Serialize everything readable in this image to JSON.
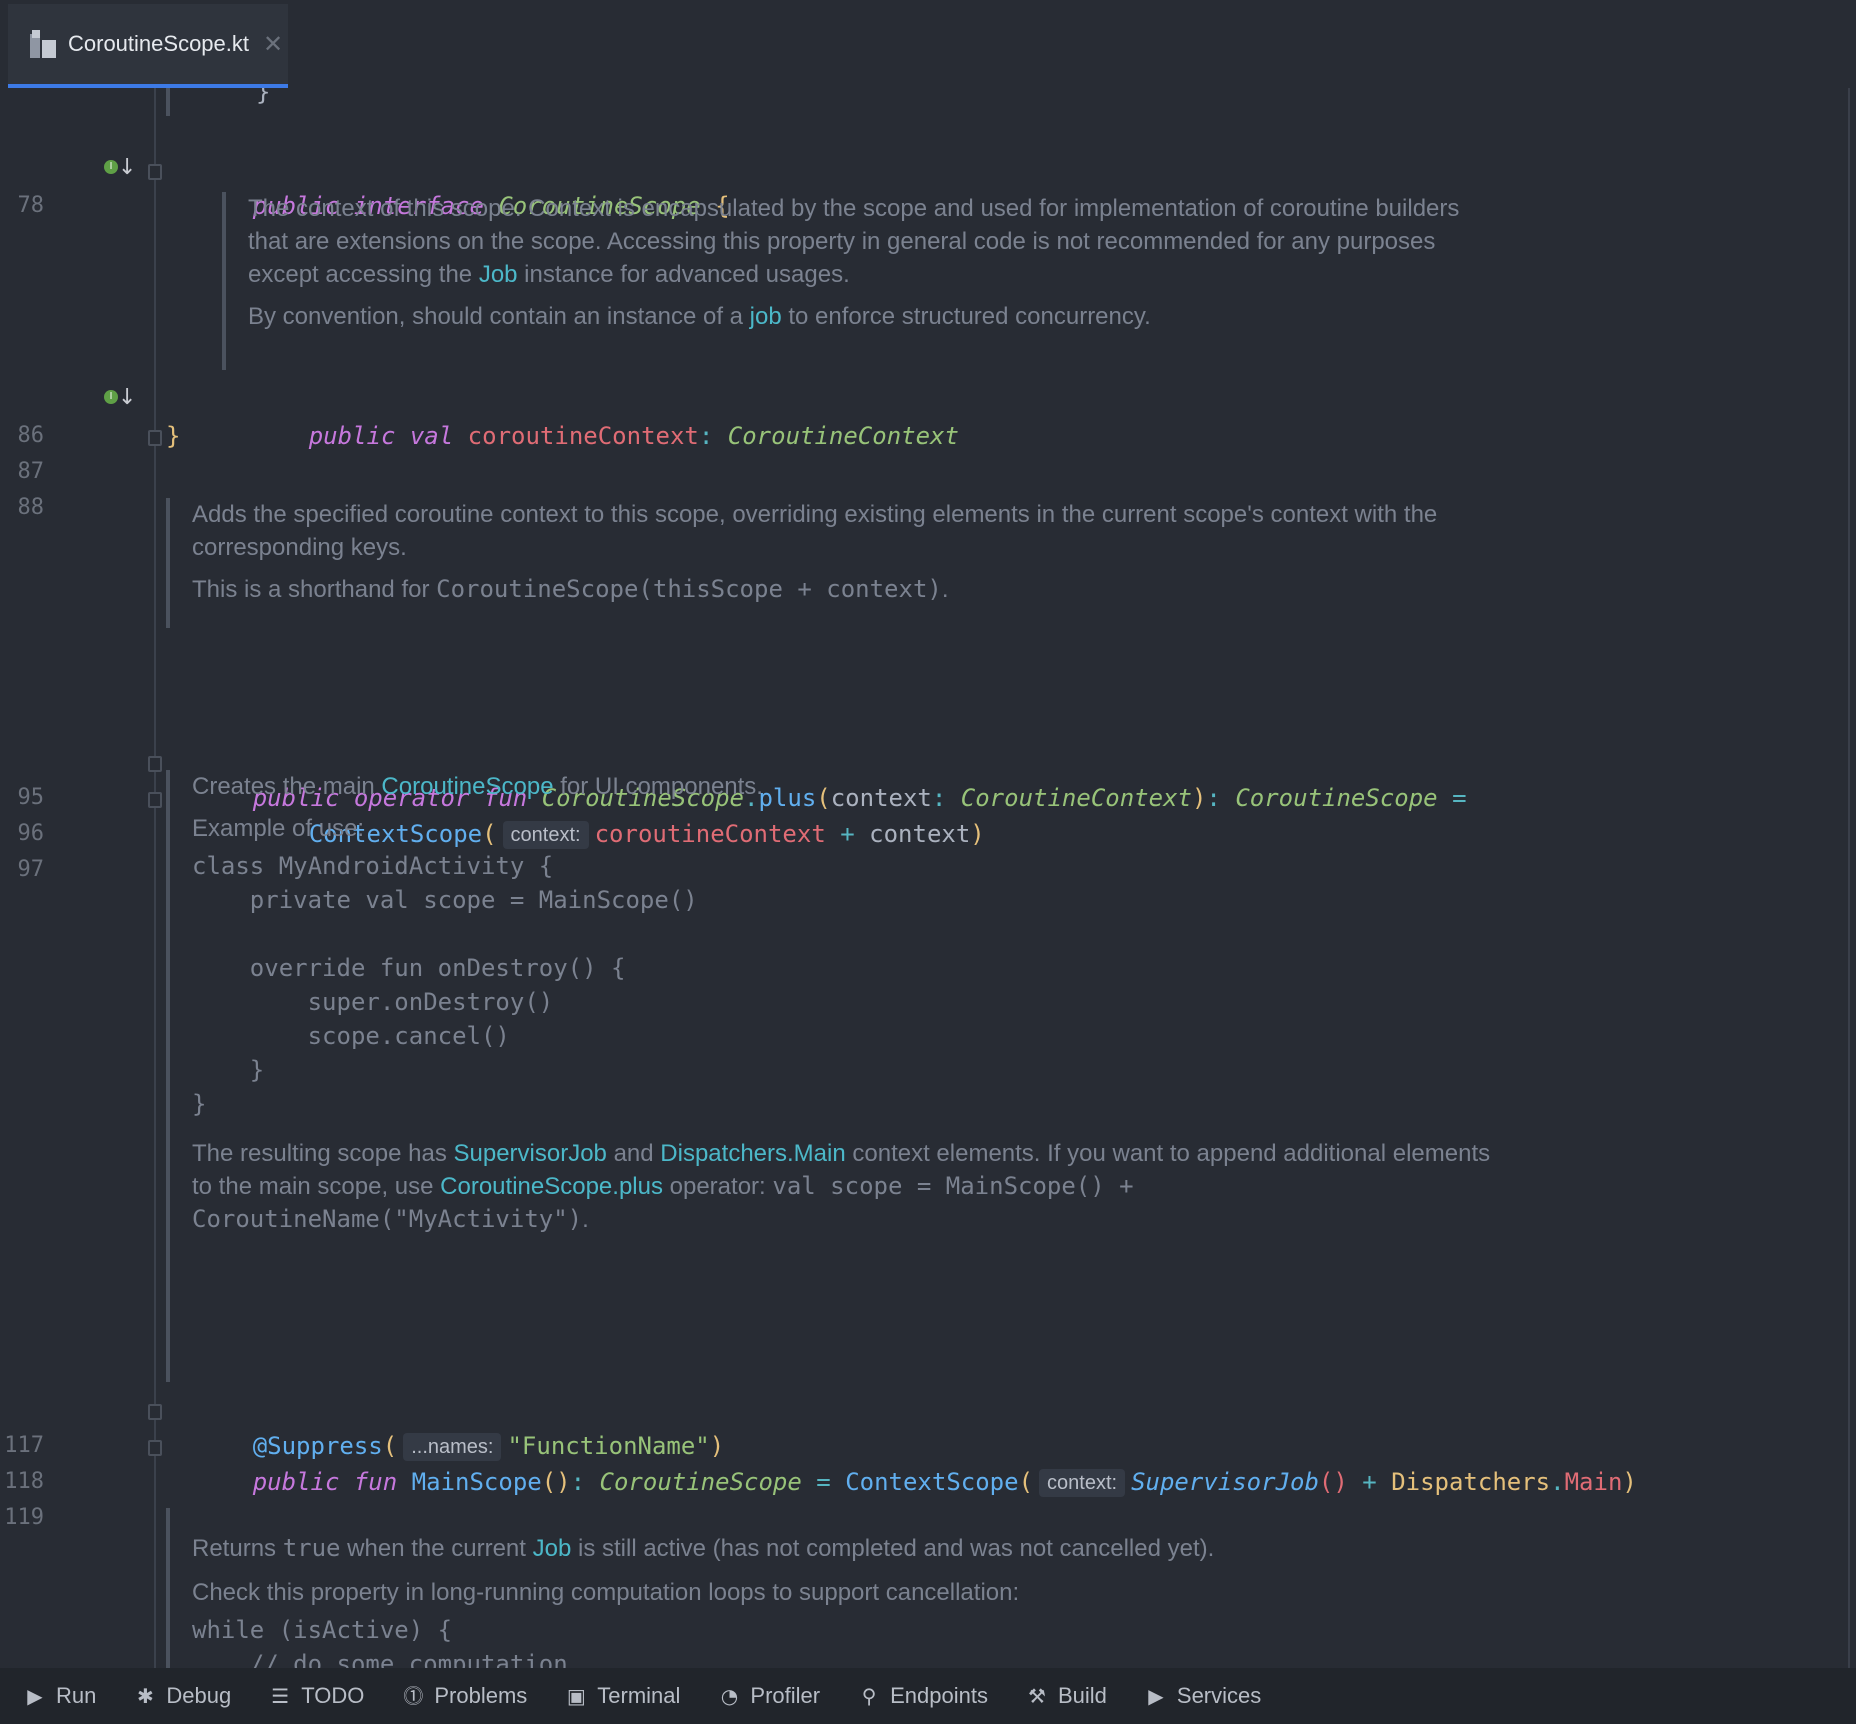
{
  "tab": {
    "label": "CoroutineScope.kt",
    "close": "✕"
  },
  "line_numbers": {
    "l78": "78",
    "l86": "86",
    "l87": "87",
    "l88": "88",
    "l95": "95",
    "l96": "96",
    "l97": "97",
    "l117": "117",
    "l118": "118",
    "l119": "119"
  },
  "code": {
    "top_brace": "}",
    "l78": {
      "kw1": "public",
      "kw2": "interface",
      "type": "CoroutineScope",
      "brace": "{"
    },
    "l86": {
      "kw1": "public",
      "kw2": "val",
      "prop": "coroutineContext",
      "colon": ":",
      "type": "CoroutineContext"
    },
    "l87": {
      "brace": "}"
    },
    "l95": {
      "kw1": "public",
      "kw2": "operator",
      "kw3": "fun",
      "recv": "CoroutineScope",
      "dot": ".",
      "fn": "plus",
      "open": "(",
      "param": "context",
      "colon": ":",
      "ptype": "CoroutineContext",
      "close": ")",
      "colon2": ":",
      "rtype": "CoroutineScope",
      "eq": "="
    },
    "l96": {
      "fn": "ContextScope",
      "open": "(",
      "hint": "context:",
      "prop": "coroutineContext",
      "plus": "+",
      "arg": "context",
      "close": ")"
    },
    "l117": {
      "ann": "@Suppress",
      "open": "(",
      "hint": "...names:",
      "str": "\"FunctionName\"",
      "close": ")"
    },
    "l118": {
      "kw1": "public",
      "kw2": "fun",
      "fn": "MainScope",
      "parens": "()",
      "colon": ":",
      "type": "CoroutineScope",
      "eq": "=",
      "fn2": "ContextScope",
      "open": "(",
      "hint": "context:",
      "sj": "SupervisorJob",
      "sjp": "()",
      "plus": "+",
      "disp": "Dispatchers",
      "dot": ".",
      "main": "Main",
      "close": ")"
    }
  },
  "docs": {
    "d1": {
      "p1_a": "The context of this scope. Context is encapsulated by the scope and used for implementation of coroutine builders that are extensions on the scope. Accessing this property in general code is not recommended for any purposes except accessing the ",
      "p1_link": "Job",
      "p1_b": " instance for advanced usages.",
      "p2_a": "By convention, should contain an instance of a ",
      "p2_link": "job",
      "p2_b": " to enforce structured concurrency."
    },
    "d2": {
      "p1": "Adds the specified coroutine context to this scope, overriding existing elements in the current scope's context with the corresponding keys.",
      "p2_a": "This is a shorthand for ",
      "p2_code": "CoroutineScope(thisScope + context)",
      "p2_b": "."
    },
    "d3": {
      "p1_a": "Creates the main ",
      "p1_link": "CoroutineScope",
      "p1_b": " for UI components.",
      "p2": "Example of use:",
      "code": "class MyAndroidActivity {\n    private val scope = MainScope()\n\n    override fun onDestroy() {\n        super.onDestroy()\n        scope.cancel()\n    }\n}",
      "p3_a": "The resulting scope has ",
      "p3_link1": "SupervisorJob",
      "p3_b": " and ",
      "p3_link2": "Dispatchers.Main",
      "p3_c": " context elements. If you want to append additional elements to the main scope, use ",
      "p3_link3": "CoroutineScope.plus",
      "p3_d": " operator: ",
      "p3_code": "val scope = MainScope() + CoroutineName(\"MyActivity\")",
      "p3_e": "."
    },
    "d4": {
      "p1_a": "Returns ",
      "p1_code": "true",
      "p1_b": " when the current ",
      "p1_link": "Job",
      "p1_c": " is still active (has not completed and was not cancelled yet).",
      "p2": "Check this property in long-running computation loops to support cancellation:",
      "code": "while (isActive) {\n    // do some computation\n}"
    }
  },
  "statusbar": [
    {
      "label": "Run",
      "icon": "▶"
    },
    {
      "label": "Debug",
      "icon": "✱"
    },
    {
      "label": "TODO",
      "icon": "☰"
    },
    {
      "label": "Problems",
      "icon": "⓵"
    },
    {
      "label": "Terminal",
      "icon": "▣"
    },
    {
      "label": "Profiler",
      "icon": "◔"
    },
    {
      "label": "Endpoints",
      "icon": "⚲"
    },
    {
      "label": "Build",
      "icon": "⚒"
    },
    {
      "label": "Services",
      "icon": "▶"
    }
  ]
}
